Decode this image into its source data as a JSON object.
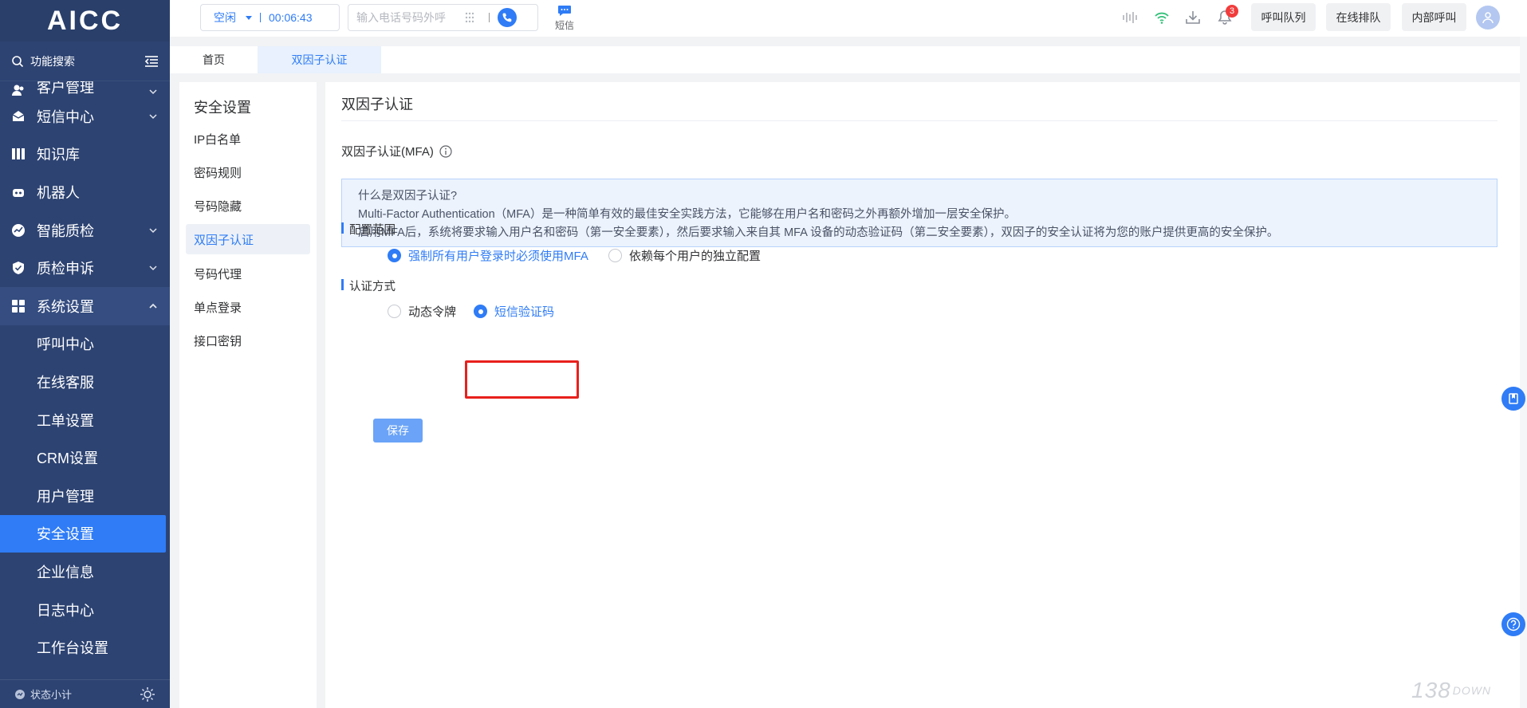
{
  "brand": {
    "logo_text": "AICC"
  },
  "sidebar": {
    "search_label": "功能搜索",
    "items": [
      {
        "label": "客户管理",
        "icon": "users-icon",
        "has_children": true
      },
      {
        "label": "短信中心",
        "icon": "mail-icon",
        "has_children": true
      },
      {
        "label": "知识库",
        "icon": "book-icon",
        "has_children": false
      },
      {
        "label": "机器人",
        "icon": "robot-icon",
        "has_children": false
      },
      {
        "label": "智能质检",
        "icon": "gauge-icon",
        "has_children": true
      },
      {
        "label": "质检申诉",
        "icon": "shield-icon",
        "has_children": true
      },
      {
        "label": "系统设置",
        "icon": "grid-icon",
        "has_children": true,
        "expanded": true
      }
    ],
    "sub_items": [
      "呼叫中心",
      "在线客服",
      "工单设置",
      "CRM设置",
      "用户管理",
      "安全设置",
      "企业信息",
      "日志中心",
      "工作台设置"
    ],
    "active_sub_item": "安全设置",
    "footer_label": "状态小计"
  },
  "topbar": {
    "agent_status": "空闲",
    "timer": "00:06:43",
    "dial_placeholder": "输入电话号码外呼",
    "sms_label": "短信",
    "notification_count": "3",
    "buttons": [
      "呼叫队列",
      "在线排队",
      "内部呼叫"
    ]
  },
  "tabs": [
    {
      "label": "首页",
      "active": false
    },
    {
      "label": "双因子认证",
      "active": true
    }
  ],
  "subnav": {
    "title": "安全设置",
    "items": [
      "IP白名单",
      "密码规则",
      "号码隐藏",
      "双因子认证",
      "号码代理",
      "单点登录",
      "接口密钥"
    ],
    "active": "双因子认证"
  },
  "main": {
    "title": "双因子认证",
    "mfa_label": "双因子认证(MFA)",
    "info_lines": [
      "什么是双因子认证?",
      "Multi-Factor Authentication（MFA）是一种简单有效的最佳安全实践方法，它能够在用户名和密码之外再额外增加一层安全保护。",
      "启用MFA后，系统将要求输入用户名和密码（第一安全要素），然后要求输入来自其 MFA 设备的动态验证码（第二安全要素），双因子的安全认证将为您的账户提供更高的安全保护。"
    ],
    "scope_heading": "配置范围",
    "scope_options": [
      {
        "label": "强制所有用户登录时必须使用MFA",
        "checked": true
      },
      {
        "label": "依赖每个用户的独立配置",
        "checked": false
      }
    ],
    "method_heading": "认证方式",
    "method_options": [
      {
        "label": "动态令牌",
        "checked": false
      },
      {
        "label": "短信验证码",
        "checked": true
      }
    ],
    "save_label": "保存"
  },
  "colors": {
    "primary": "#2f7cf6",
    "sidebar_bg": "#2d4372",
    "highlight_border": "#e8201c"
  },
  "watermark": {
    "text": "138",
    "suffix": "DOWN"
  }
}
